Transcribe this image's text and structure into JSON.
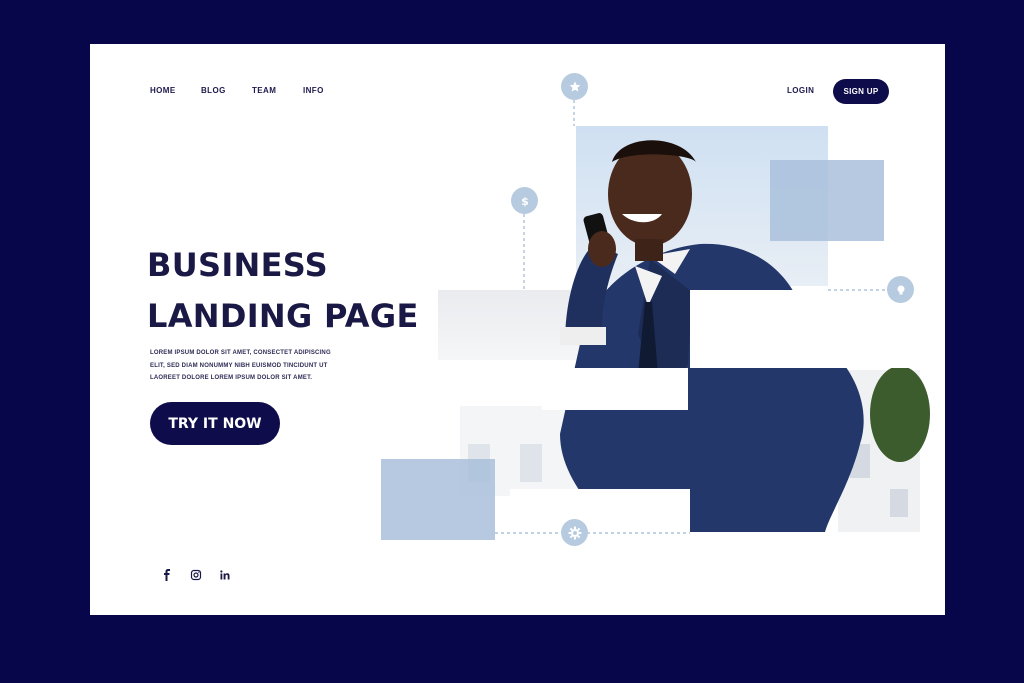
{
  "nav": {
    "items": [
      "HOME",
      "BLOG",
      "TEAM",
      "INFO"
    ],
    "login": "LOGIN",
    "signup": "SIGN UP"
  },
  "hero": {
    "title_line1": "BUSINESS",
    "title_line2": "LANDING PAGE",
    "desc_lines": [
      "LOREM IPSUM DOLOR SIT AMET, CONSECTET ADIPISCING",
      "ELIT, SED DIAM NONUMMY NIBH EUISMOD TINCIDUNT UT",
      "LAOREET DOLORE LOREM IPSUM DOLOR SIT AMET."
    ],
    "cta": "TRY IT NOW"
  },
  "icons": {
    "social": [
      "facebook-icon",
      "instagram-icon",
      "linkedin-icon"
    ],
    "decor": [
      "star-icon",
      "dollar-icon",
      "lightbulb-icon",
      "gear-icon"
    ]
  },
  "colors": {
    "background": "#07064a",
    "navy": "#0e0c4a",
    "text": "#1a1845",
    "accent_light": "#b7cbe0",
    "square": "#a9c0db"
  }
}
